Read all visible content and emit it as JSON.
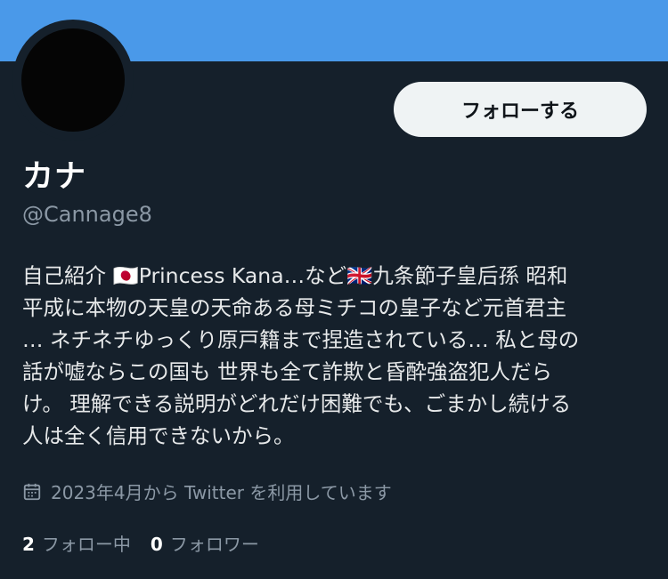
{
  "profile": {
    "display_name": "カナ",
    "handle": "@Cannage8",
    "follow_button": "フォローする",
    "bio_lines": [
      "自己紹介 🇯🇵Princess Kana…など🇬🇧九条節子皇后孫 昭和",
      "平成に本物の天皇の天命ある母ミチコの皇子など元首君主",
      "… ネチネチゆっくり原戸籍まで捏造されている… 私と母の",
      "話が嘘ならこの国も 世界も全て詐欺と昏酔強盗犯人だら",
      "け。 理解できる説明がどれだけ困難でも、ごまかし続ける",
      "人は全く信用できないから。"
    ],
    "joined": "2023年4月から Twitter を利用しています",
    "following_count": "2",
    "following_label": "フォロー中",
    "followers_count": "0",
    "followers_label": "フォロワー"
  },
  "icons": {
    "joined": "calendar-icon"
  },
  "colors": {
    "banner": "#4a99e9",
    "background": "#15202b",
    "button_bg": "#eff3f4",
    "secondary_text": "#8b98a5"
  }
}
